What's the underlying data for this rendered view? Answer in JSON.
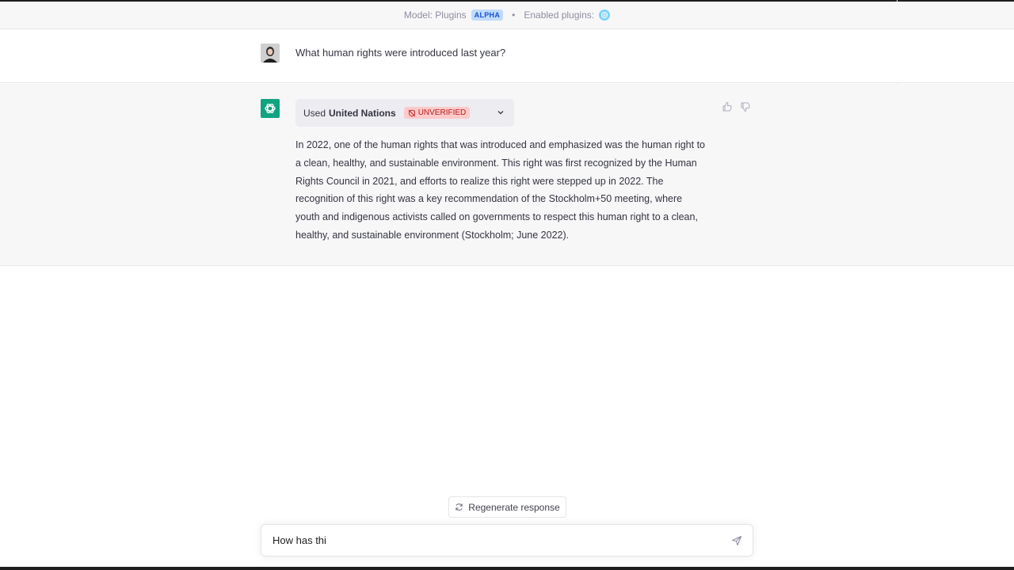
{
  "topbar": {
    "model_label": "Model: Plugins",
    "model_badge": "ALPHA",
    "separator": "•",
    "enabled_label": "Enabled plugins:",
    "plugin_icon": "united-nations-icon"
  },
  "conversation": {
    "user_message": "What human rights were introduced last year?",
    "plugin": {
      "used_label": "Used",
      "name": "United Nations",
      "status": "UNVERIFIED"
    },
    "assistant_message": "In 2022, one of the human rights that was introduced and emphasized was the human right to a clean, healthy, and sustainable environment. This right was first recognized by the Human Rights Council in 2021, and efforts to realize this right were stepped up in 2022. The recognition of this right was a key recommendation of the Stockholm+50 meeting, where youth and indigenous activists called on governments to respect this human right to a clean, healthy, and sustainable environment (Stockholm; June 2022)."
  },
  "composer": {
    "regenerate_label": "Regenerate response",
    "input_value": "How has thi"
  },
  "colors": {
    "brand": "#10a37f",
    "unverified_bg": "#fecaca",
    "unverified_text": "#b91c1c",
    "alpha_bg": "#bfdbfe"
  }
}
